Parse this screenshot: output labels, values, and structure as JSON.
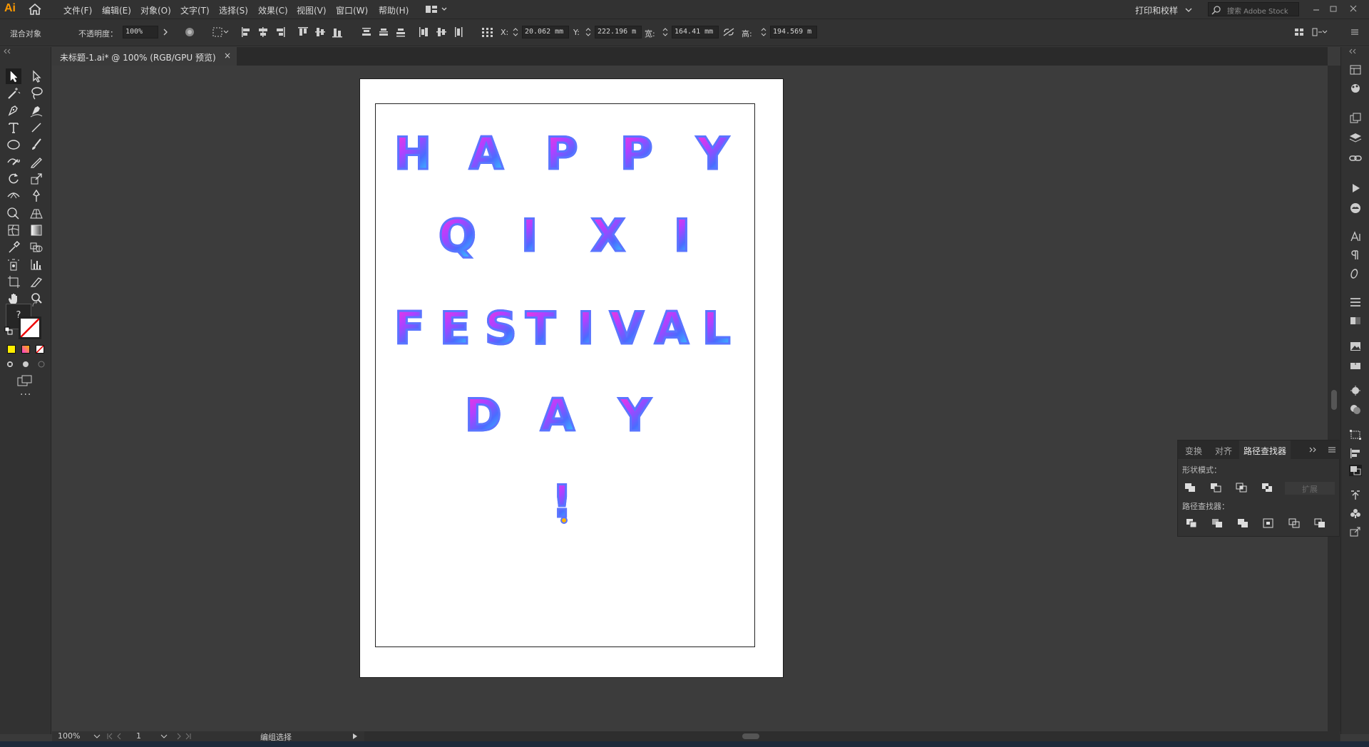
{
  "app": {
    "logo": "Ai",
    "menus": [
      "文件(F)",
      "编辑(E)",
      "对象(O)",
      "文字(T)",
      "选择(S)",
      "效果(C)",
      "视图(V)",
      "窗口(W)",
      "帮助(H)"
    ],
    "workspace": "打印和校样",
    "search_placeholder": "搜索 Adobe Stock"
  },
  "control_bar": {
    "object_type": "混合对象",
    "opacity_label": "不透明度：",
    "opacity_value": "100%",
    "x_label": "X:",
    "x_value": "20.062 mm",
    "y_label": "Y:",
    "y_value": "222.196 m",
    "w_label": "宽:",
    "w_value": "164.41 mm",
    "h_label": "高:",
    "h_value": "194.569 m"
  },
  "document": {
    "tab_title": "未标题-1.ai* @ 100% (RGB/GPU 预览)",
    "close": "×"
  },
  "artwork": {
    "line1": [
      "H",
      "A",
      "P",
      "P",
      "Y"
    ],
    "line2": [
      "Q",
      "I",
      "X",
      "I"
    ],
    "line3": [
      "F",
      "E",
      "S",
      "T",
      "I",
      "V",
      "A",
      "L"
    ],
    "line4": [
      "D",
      "A",
      "Y"
    ],
    "line5": [
      "!"
    ]
  },
  "pathfinder_panel": {
    "tabs": [
      "变换",
      "对齐",
      "路径查找器"
    ],
    "active_tab": "路径查找器",
    "shape_modes_label": "形状模式：",
    "expand_label": "扩展",
    "pathfinders_label": "路径查找器："
  },
  "status_bar": {
    "zoom": "100%",
    "artboard": "1",
    "tool_status": "编组选择"
  },
  "toolbar": {
    "unknown_swatch": "?",
    "more": "···"
  }
}
